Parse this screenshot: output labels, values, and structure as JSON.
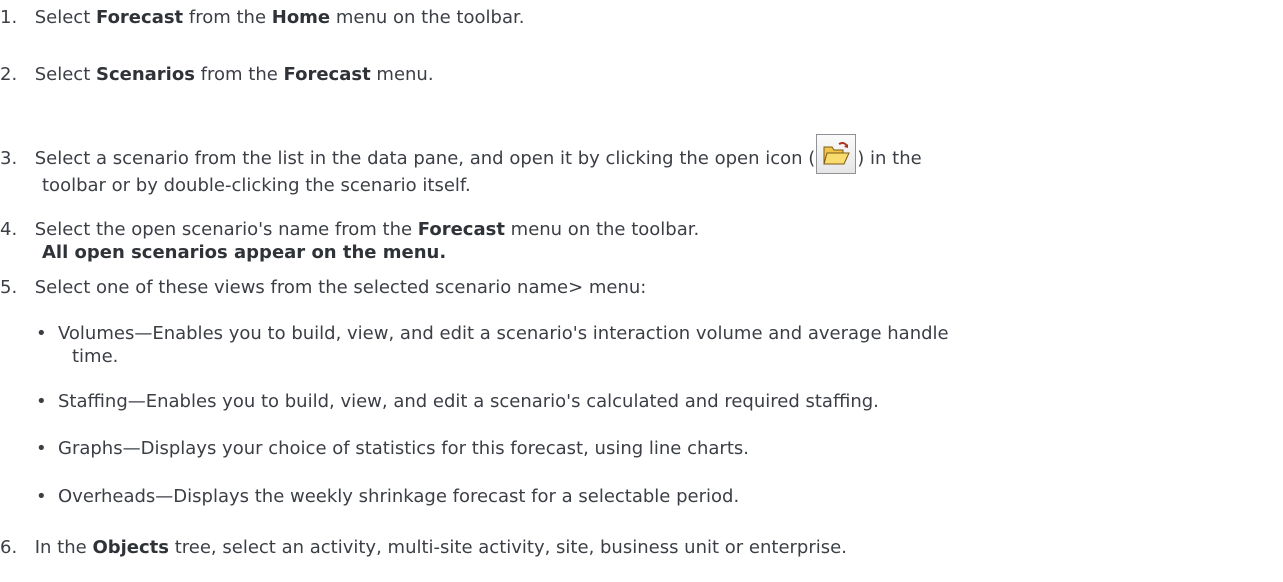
{
  "steps": [
    {
      "num": "1.",
      "parts": [
        "Select ",
        "Forecast",
        " from the ",
        "Home",
        " menu on the toolbar."
      ]
    },
    {
      "num": "2.",
      "parts": [
        "Select ",
        "Scenarios",
        " from the ",
        "Forecast",
        " menu."
      ]
    },
    {
      "num": "3.",
      "pre": "Select a scenario from the list in the data pane, and open it by clicking the open icon (",
      "post": ") in the",
      "line2": "toolbar or by double-clicking the scenario itself."
    },
    {
      "num": "4.",
      "parts": [
        "Select the open scenario's name from the ",
        "Forecast",
        " menu on the toolbar."
      ],
      "line2": "All open scenarios appear on the menu."
    },
    {
      "num": "5.",
      "text": "Select one of these views from the selected scenario name> menu:"
    },
    {
      "num": "6.",
      "parts": [
        "In the ",
        "Objects",
        " tree, select an activity, multi-site activity, site, business unit or enterprise."
      ]
    }
  ],
  "bullets": [
    {
      "dot": "•",
      "text": "Volumes—Enables you to build, view, and edit a scenario's interaction volume and average handle",
      "line2": "time."
    },
    {
      "dot": "•",
      "text": "Staffing—Enables you to build, view, and edit a scenario's calculated and required staffing."
    },
    {
      "dot": "•",
      "text": "Graphs—Displays your choice of statistics for this forecast, using line charts."
    },
    {
      "dot": "•",
      "text": "Overheads—Displays the weekly shrinkage forecast for a selectable period."
    }
  ]
}
